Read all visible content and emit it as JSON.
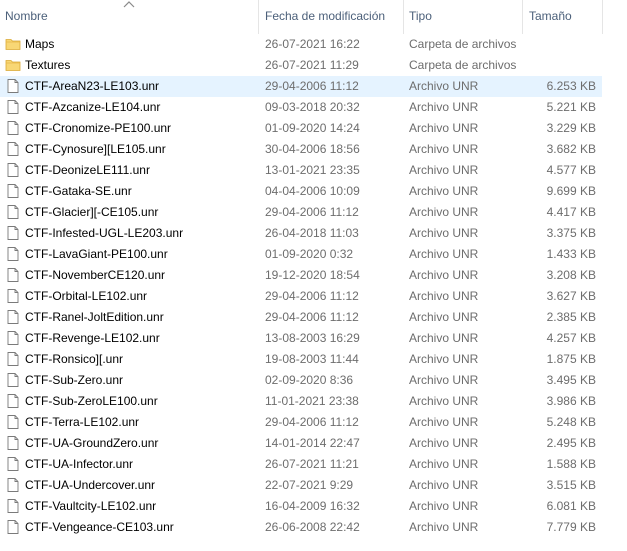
{
  "columns": {
    "name": "Nombre",
    "date": "Fecha de modificación",
    "type": "Tipo",
    "size": "Tamaño"
  },
  "sort": {
    "column": "name",
    "icon": "sort-up-chevron-icon"
  },
  "colors": {
    "selected_row": "#e5f3ff",
    "folder": "#f8d775",
    "header_text": "#4c607a",
    "meta_text": "#6d6d6d"
  },
  "files": [
    {
      "name": "Maps",
      "date": "26-07-2021 16:22",
      "type": "Carpeta de archivos",
      "size": "",
      "icon": "folder-icon",
      "selected": false
    },
    {
      "name": "Textures",
      "date": "26-07-2021 11:29",
      "type": "Carpeta de archivos",
      "size": "",
      "icon": "folder-icon",
      "selected": false
    },
    {
      "name": "CTF-AreaN23-LE103.unr",
      "date": "29-04-2006 11:12",
      "type": "Archivo UNR",
      "size": "6.253 KB",
      "icon": "file-icon",
      "selected": true
    },
    {
      "name": "CTF-Azcanize-LE104.unr",
      "date": "09-03-2018 20:32",
      "type": "Archivo UNR",
      "size": "5.221 KB",
      "icon": "file-icon",
      "selected": false
    },
    {
      "name": "CTF-Cronomize-PE100.unr",
      "date": "01-09-2020 14:24",
      "type": "Archivo UNR",
      "size": "3.229 KB",
      "icon": "file-icon",
      "selected": false
    },
    {
      "name": "CTF-Cynosure][LE105.unr",
      "date": "30-04-2006 18:56",
      "type": "Archivo UNR",
      "size": "3.682 KB",
      "icon": "file-icon",
      "selected": false
    },
    {
      "name": "CTF-DeonizeLE111.unr",
      "date": "13-01-2021 23:35",
      "type": "Archivo UNR",
      "size": "4.577 KB",
      "icon": "file-icon",
      "selected": false
    },
    {
      "name": "CTF-Gataka-SE.unr",
      "date": "04-04-2006 10:09",
      "type": "Archivo UNR",
      "size": "9.699 KB",
      "icon": "file-icon",
      "selected": false
    },
    {
      "name": "CTF-Glacier][-CE105.unr",
      "date": "29-04-2006 11:12",
      "type": "Archivo UNR",
      "size": "4.417 KB",
      "icon": "file-icon",
      "selected": false
    },
    {
      "name": "CTF-Infested-UGL-LE203.unr",
      "date": "26-04-2018 11:03",
      "type": "Archivo UNR",
      "size": "3.375 KB",
      "icon": "file-icon",
      "selected": false
    },
    {
      "name": "CTF-LavaGiant-PE100.unr",
      "date": "01-09-2020 0:32",
      "type": "Archivo UNR",
      "size": "1.433 KB",
      "icon": "file-icon",
      "selected": false
    },
    {
      "name": "CTF-NovemberCE120.unr",
      "date": "19-12-2020 18:54",
      "type": "Archivo UNR",
      "size": "3.208 KB",
      "icon": "file-icon",
      "selected": false
    },
    {
      "name": "CTF-Orbital-LE102.unr",
      "date": "29-04-2006 11:12",
      "type": "Archivo UNR",
      "size": "3.627 KB",
      "icon": "file-icon",
      "selected": false
    },
    {
      "name": "CTF-Ranel-JoltEdition.unr",
      "date": "29-04-2006 11:12",
      "type": "Archivo UNR",
      "size": "2.385 KB",
      "icon": "file-icon",
      "selected": false
    },
    {
      "name": "CTF-Revenge-LE102.unr",
      "date": "13-08-2003 16:29",
      "type": "Archivo UNR",
      "size": "4.257 KB",
      "icon": "file-icon",
      "selected": false
    },
    {
      "name": "CTF-Ronsico][.unr",
      "date": "19-08-2003 11:44",
      "type": "Archivo UNR",
      "size": "1.875 KB",
      "icon": "file-icon",
      "selected": false
    },
    {
      "name": "CTF-Sub-Zero.unr",
      "date": "02-09-2020 8:36",
      "type": "Archivo UNR",
      "size": "3.495 KB",
      "icon": "file-icon",
      "selected": false
    },
    {
      "name": "CTF-Sub-ZeroLE100.unr",
      "date": "11-01-2021 23:38",
      "type": "Archivo UNR",
      "size": "3.986 KB",
      "icon": "file-icon",
      "selected": false
    },
    {
      "name": "CTF-Terra-LE102.unr",
      "date": "29-04-2006 11:12",
      "type": "Archivo UNR",
      "size": "5.248 KB",
      "icon": "file-icon",
      "selected": false
    },
    {
      "name": "CTF-UA-GroundZero.unr",
      "date": "14-01-2014 22:47",
      "type": "Archivo UNR",
      "size": "2.495 KB",
      "icon": "file-icon",
      "selected": false
    },
    {
      "name": "CTF-UA-Infector.unr",
      "date": "26-07-2021 11:21",
      "type": "Archivo UNR",
      "size": "1.588 KB",
      "icon": "file-icon",
      "selected": false
    },
    {
      "name": "CTF-UA-Undercover.unr",
      "date": "22-07-2021 9:29",
      "type": "Archivo UNR",
      "size": "3.515 KB",
      "icon": "file-icon",
      "selected": false
    },
    {
      "name": "CTF-Vaultcity-LE102.unr",
      "date": "16-04-2009 16:32",
      "type": "Archivo UNR",
      "size": "6.081 KB",
      "icon": "file-icon",
      "selected": false
    },
    {
      "name": "CTF-Vengeance-CE103.unr",
      "date": "26-06-2008 22:42",
      "type": "Archivo UNR",
      "size": "7.779 KB",
      "icon": "file-icon",
      "selected": false
    }
  ]
}
